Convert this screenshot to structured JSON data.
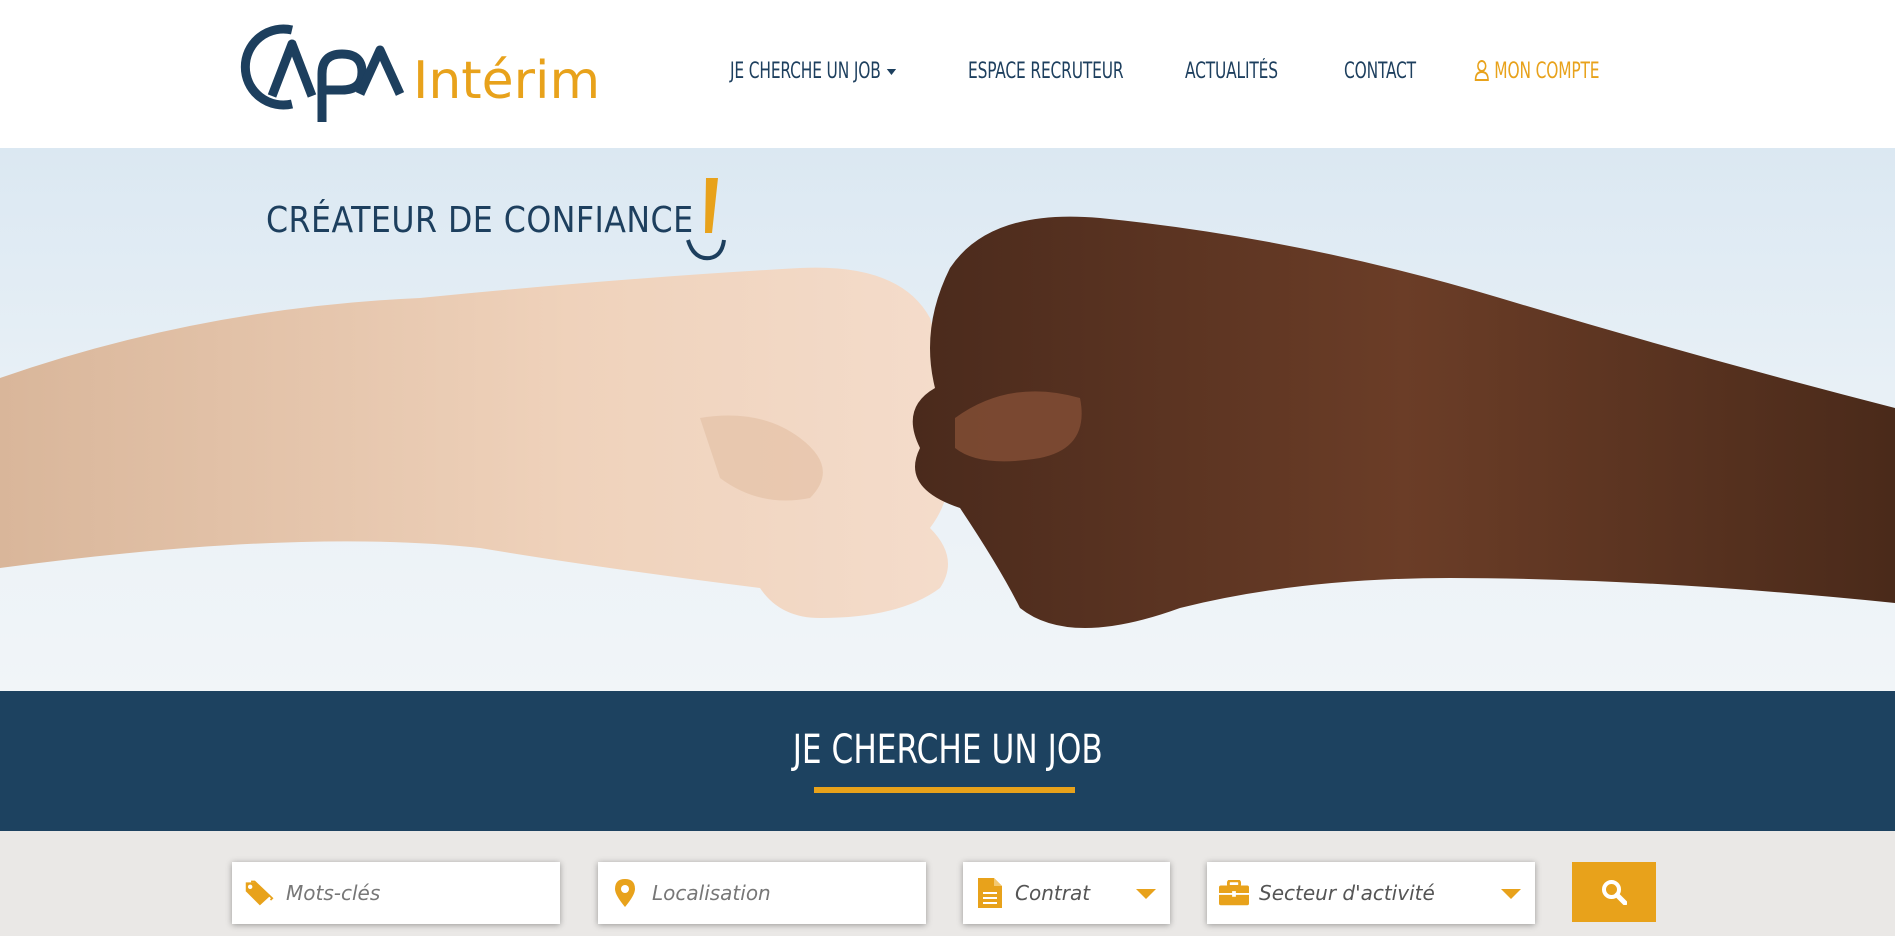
{
  "brand": {
    "logo_text": "CAPA",
    "logo_suffix": "Intérim",
    "primary_color": "#1d3f5e",
    "accent_color": "#e8a21b"
  },
  "nav": {
    "items": [
      {
        "label": "JE CHERCHE UN JOB",
        "has_dropdown": true
      },
      {
        "label": "ESPACE RECRUTEUR"
      },
      {
        "label": "ACTUALITÉS"
      },
      {
        "label": "CONTACT"
      }
    ],
    "account": {
      "label": "MON COMPTE",
      "icon": "user-icon"
    }
  },
  "hero": {
    "tagline": "CRÉATEUR DE CONFIANCE"
  },
  "band": {
    "title": "JE CHERCHE UN JOB"
  },
  "search": {
    "keywords": {
      "placeholder": "Mots-clés",
      "icon": "tags-icon"
    },
    "location": {
      "placeholder": "Localisation",
      "icon": "map-pin-icon"
    },
    "contract": {
      "value": "Contrat",
      "icon": "document-icon"
    },
    "sector": {
      "value": "Secteur d'activité",
      "icon": "briefcase-icon"
    },
    "button_icon": "search-icon"
  }
}
